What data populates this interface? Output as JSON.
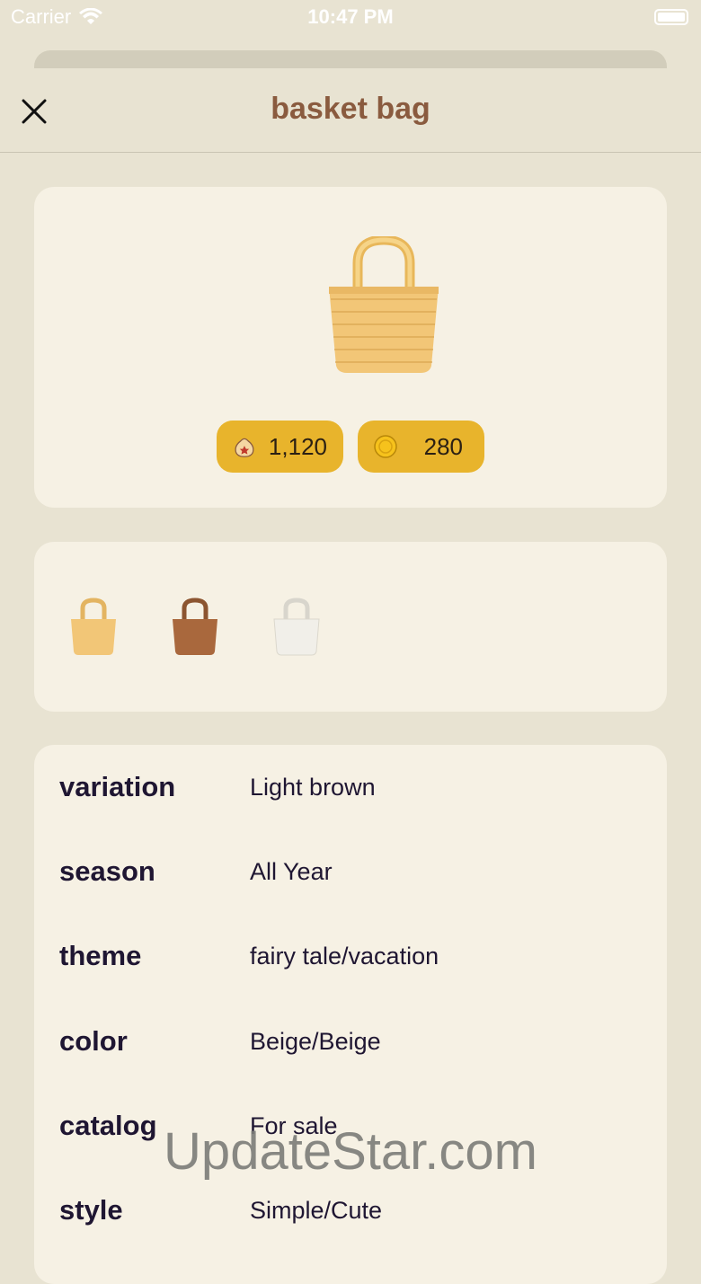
{
  "status": {
    "carrier": "Carrier",
    "time": "10:47 PM"
  },
  "nav": {
    "title": "basket bag"
  },
  "item": {
    "buy_price": "1,120",
    "sell_price": "280"
  },
  "variants": [
    {
      "name": "Light brown",
      "color": "#f2c677"
    },
    {
      "name": "Brown",
      "color": "#a9683d"
    },
    {
      "name": "White",
      "color": "#f1efe9"
    }
  ],
  "details": [
    {
      "key": "variation",
      "value": "Light brown"
    },
    {
      "key": "season",
      "value": "All Year"
    },
    {
      "key": "theme",
      "value": "fairy tale/vacation"
    },
    {
      "key": "color",
      "value": "Beige/Beige"
    },
    {
      "key": "catalog",
      "value": "For sale"
    },
    {
      "key": "style",
      "value": "Simple/Cute"
    }
  ],
  "watermark": "UpdateStar.com",
  "colors": {
    "accent": "#e8b42c",
    "title": "#8a5b3f",
    "background": "#e8e3d2",
    "card": "#f6f1e4"
  }
}
